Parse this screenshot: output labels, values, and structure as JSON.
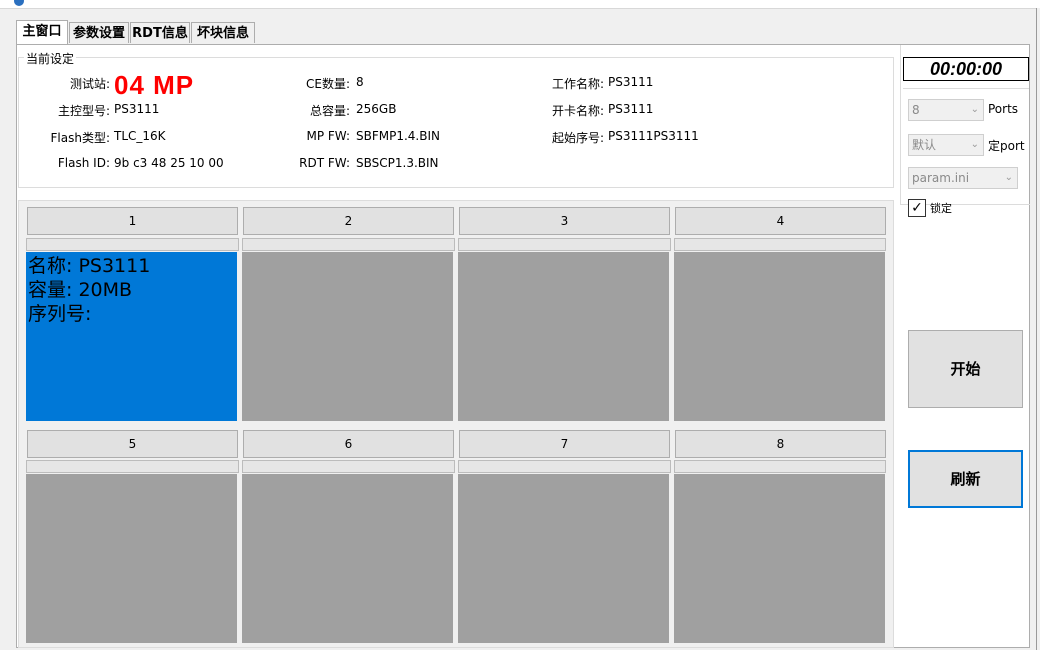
{
  "tabs": [
    {
      "label": "主窗口",
      "active": true
    },
    {
      "label": "参数设置",
      "active": false
    },
    {
      "label": "RDT信息",
      "active": false
    },
    {
      "label": "坏块信息",
      "active": false
    }
  ],
  "settings": {
    "group_title": "当前设定",
    "station_label": "测试站:",
    "station_value": "04  MP",
    "controller_label": "主控型号:",
    "controller_value": "PS3111",
    "flash_type_label": "Flash类型:",
    "flash_type_value": "TLC_16K",
    "flash_id_label": "Flash ID:",
    "flash_id_value": "9b c3 48 25 10 00",
    "ce_label": "CE数量:",
    "ce_value": "8",
    "capacity_label": "总容量:",
    "capacity_value": "256GB",
    "mpfw_label": "MP FW:",
    "mpfw_value": "SBFMP1.4.BIN",
    "rdtfw_label": "RDT FW:",
    "rdtfw_value": "SBSCP1.3.BIN",
    "job_label": "工作名称:",
    "job_value": "PS3111",
    "card_label": "开卡名称:",
    "card_value": "PS3111",
    "serial_label": "起始序号:",
    "serial_value": "PS3111PS3111"
  },
  "slots": [
    {
      "label": "1",
      "active": true,
      "info": "名称: PS3111\n容量: 20MB\n序列号:"
    },
    {
      "label": "2",
      "active": false,
      "info": ""
    },
    {
      "label": "3",
      "active": false,
      "info": ""
    },
    {
      "label": "4",
      "active": false,
      "info": ""
    },
    {
      "label": "5",
      "active": false,
      "info": ""
    },
    {
      "label": "6",
      "active": false,
      "info": ""
    },
    {
      "label": "7",
      "active": false,
      "info": ""
    },
    {
      "label": "8",
      "active": false,
      "info": ""
    }
  ],
  "right": {
    "timer": "00:00:00",
    "ports_value": "8",
    "ports_label": "Ports",
    "mode_value": "默认",
    "mode_label": "定port",
    "ini_value": "param.ini",
    "lock_label": "锁定",
    "lock_checked": true,
    "start_label": "开始",
    "refresh_label": "刷新"
  },
  "colors": {
    "active_slot": "#0078d7",
    "idle_slot": "#a0a0a0",
    "station_text": "#ff0000"
  }
}
